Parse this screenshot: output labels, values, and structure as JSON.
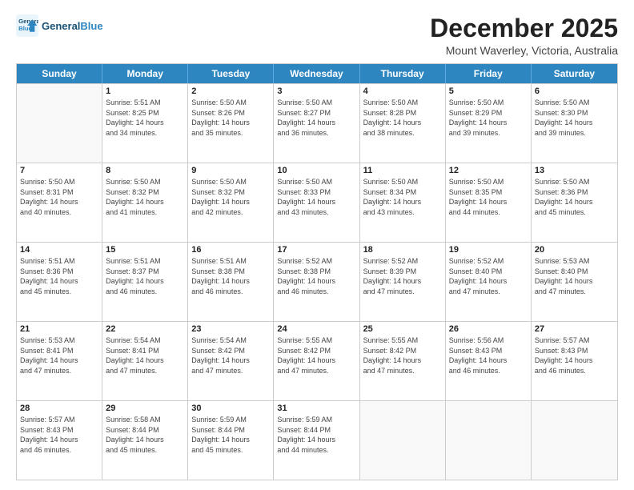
{
  "header": {
    "logo_line1": "General",
    "logo_line2": "Blue",
    "month": "December 2025",
    "location": "Mount Waverley, Victoria, Australia"
  },
  "days_of_week": [
    "Sunday",
    "Monday",
    "Tuesday",
    "Wednesday",
    "Thursday",
    "Friday",
    "Saturday"
  ],
  "rows": [
    [
      {
        "day": "",
        "lines": []
      },
      {
        "day": "1",
        "lines": [
          "Sunrise: 5:51 AM",
          "Sunset: 8:25 PM",
          "Daylight: 14 hours",
          "and 34 minutes."
        ]
      },
      {
        "day": "2",
        "lines": [
          "Sunrise: 5:50 AM",
          "Sunset: 8:26 PM",
          "Daylight: 14 hours",
          "and 35 minutes."
        ]
      },
      {
        "day": "3",
        "lines": [
          "Sunrise: 5:50 AM",
          "Sunset: 8:27 PM",
          "Daylight: 14 hours",
          "and 36 minutes."
        ]
      },
      {
        "day": "4",
        "lines": [
          "Sunrise: 5:50 AM",
          "Sunset: 8:28 PM",
          "Daylight: 14 hours",
          "and 38 minutes."
        ]
      },
      {
        "day": "5",
        "lines": [
          "Sunrise: 5:50 AM",
          "Sunset: 8:29 PM",
          "Daylight: 14 hours",
          "and 39 minutes."
        ]
      },
      {
        "day": "6",
        "lines": [
          "Sunrise: 5:50 AM",
          "Sunset: 8:30 PM",
          "Daylight: 14 hours",
          "and 39 minutes."
        ]
      }
    ],
    [
      {
        "day": "7",
        "lines": [
          "Sunrise: 5:50 AM",
          "Sunset: 8:31 PM",
          "Daylight: 14 hours",
          "and 40 minutes."
        ]
      },
      {
        "day": "8",
        "lines": [
          "Sunrise: 5:50 AM",
          "Sunset: 8:32 PM",
          "Daylight: 14 hours",
          "and 41 minutes."
        ]
      },
      {
        "day": "9",
        "lines": [
          "Sunrise: 5:50 AM",
          "Sunset: 8:32 PM",
          "Daylight: 14 hours",
          "and 42 minutes."
        ]
      },
      {
        "day": "10",
        "lines": [
          "Sunrise: 5:50 AM",
          "Sunset: 8:33 PM",
          "Daylight: 14 hours",
          "and 43 minutes."
        ]
      },
      {
        "day": "11",
        "lines": [
          "Sunrise: 5:50 AM",
          "Sunset: 8:34 PM",
          "Daylight: 14 hours",
          "and 43 minutes."
        ]
      },
      {
        "day": "12",
        "lines": [
          "Sunrise: 5:50 AM",
          "Sunset: 8:35 PM",
          "Daylight: 14 hours",
          "and 44 minutes."
        ]
      },
      {
        "day": "13",
        "lines": [
          "Sunrise: 5:50 AM",
          "Sunset: 8:36 PM",
          "Daylight: 14 hours",
          "and 45 minutes."
        ]
      }
    ],
    [
      {
        "day": "14",
        "lines": [
          "Sunrise: 5:51 AM",
          "Sunset: 8:36 PM",
          "Daylight: 14 hours",
          "and 45 minutes."
        ]
      },
      {
        "day": "15",
        "lines": [
          "Sunrise: 5:51 AM",
          "Sunset: 8:37 PM",
          "Daylight: 14 hours",
          "and 46 minutes."
        ]
      },
      {
        "day": "16",
        "lines": [
          "Sunrise: 5:51 AM",
          "Sunset: 8:38 PM",
          "Daylight: 14 hours",
          "and 46 minutes."
        ]
      },
      {
        "day": "17",
        "lines": [
          "Sunrise: 5:52 AM",
          "Sunset: 8:38 PM",
          "Daylight: 14 hours",
          "and 46 minutes."
        ]
      },
      {
        "day": "18",
        "lines": [
          "Sunrise: 5:52 AM",
          "Sunset: 8:39 PM",
          "Daylight: 14 hours",
          "and 47 minutes."
        ]
      },
      {
        "day": "19",
        "lines": [
          "Sunrise: 5:52 AM",
          "Sunset: 8:40 PM",
          "Daylight: 14 hours",
          "and 47 minutes."
        ]
      },
      {
        "day": "20",
        "lines": [
          "Sunrise: 5:53 AM",
          "Sunset: 8:40 PM",
          "Daylight: 14 hours",
          "and 47 minutes."
        ]
      }
    ],
    [
      {
        "day": "21",
        "lines": [
          "Sunrise: 5:53 AM",
          "Sunset: 8:41 PM",
          "Daylight: 14 hours",
          "and 47 minutes."
        ]
      },
      {
        "day": "22",
        "lines": [
          "Sunrise: 5:54 AM",
          "Sunset: 8:41 PM",
          "Daylight: 14 hours",
          "and 47 minutes."
        ]
      },
      {
        "day": "23",
        "lines": [
          "Sunrise: 5:54 AM",
          "Sunset: 8:42 PM",
          "Daylight: 14 hours",
          "and 47 minutes."
        ]
      },
      {
        "day": "24",
        "lines": [
          "Sunrise: 5:55 AM",
          "Sunset: 8:42 PM",
          "Daylight: 14 hours",
          "and 47 minutes."
        ]
      },
      {
        "day": "25",
        "lines": [
          "Sunrise: 5:55 AM",
          "Sunset: 8:42 PM",
          "Daylight: 14 hours",
          "and 47 minutes."
        ]
      },
      {
        "day": "26",
        "lines": [
          "Sunrise: 5:56 AM",
          "Sunset: 8:43 PM",
          "Daylight: 14 hours",
          "and 46 minutes."
        ]
      },
      {
        "day": "27",
        "lines": [
          "Sunrise: 5:57 AM",
          "Sunset: 8:43 PM",
          "Daylight: 14 hours",
          "and 46 minutes."
        ]
      }
    ],
    [
      {
        "day": "28",
        "lines": [
          "Sunrise: 5:57 AM",
          "Sunset: 8:43 PM",
          "Daylight: 14 hours",
          "and 46 minutes."
        ]
      },
      {
        "day": "29",
        "lines": [
          "Sunrise: 5:58 AM",
          "Sunset: 8:44 PM",
          "Daylight: 14 hours",
          "and 45 minutes."
        ]
      },
      {
        "day": "30",
        "lines": [
          "Sunrise: 5:59 AM",
          "Sunset: 8:44 PM",
          "Daylight: 14 hours",
          "and 45 minutes."
        ]
      },
      {
        "day": "31",
        "lines": [
          "Sunrise: 5:59 AM",
          "Sunset: 8:44 PM",
          "Daylight: 14 hours",
          "and 44 minutes."
        ]
      },
      {
        "day": "",
        "lines": []
      },
      {
        "day": "",
        "lines": []
      },
      {
        "day": "",
        "lines": []
      }
    ]
  ]
}
